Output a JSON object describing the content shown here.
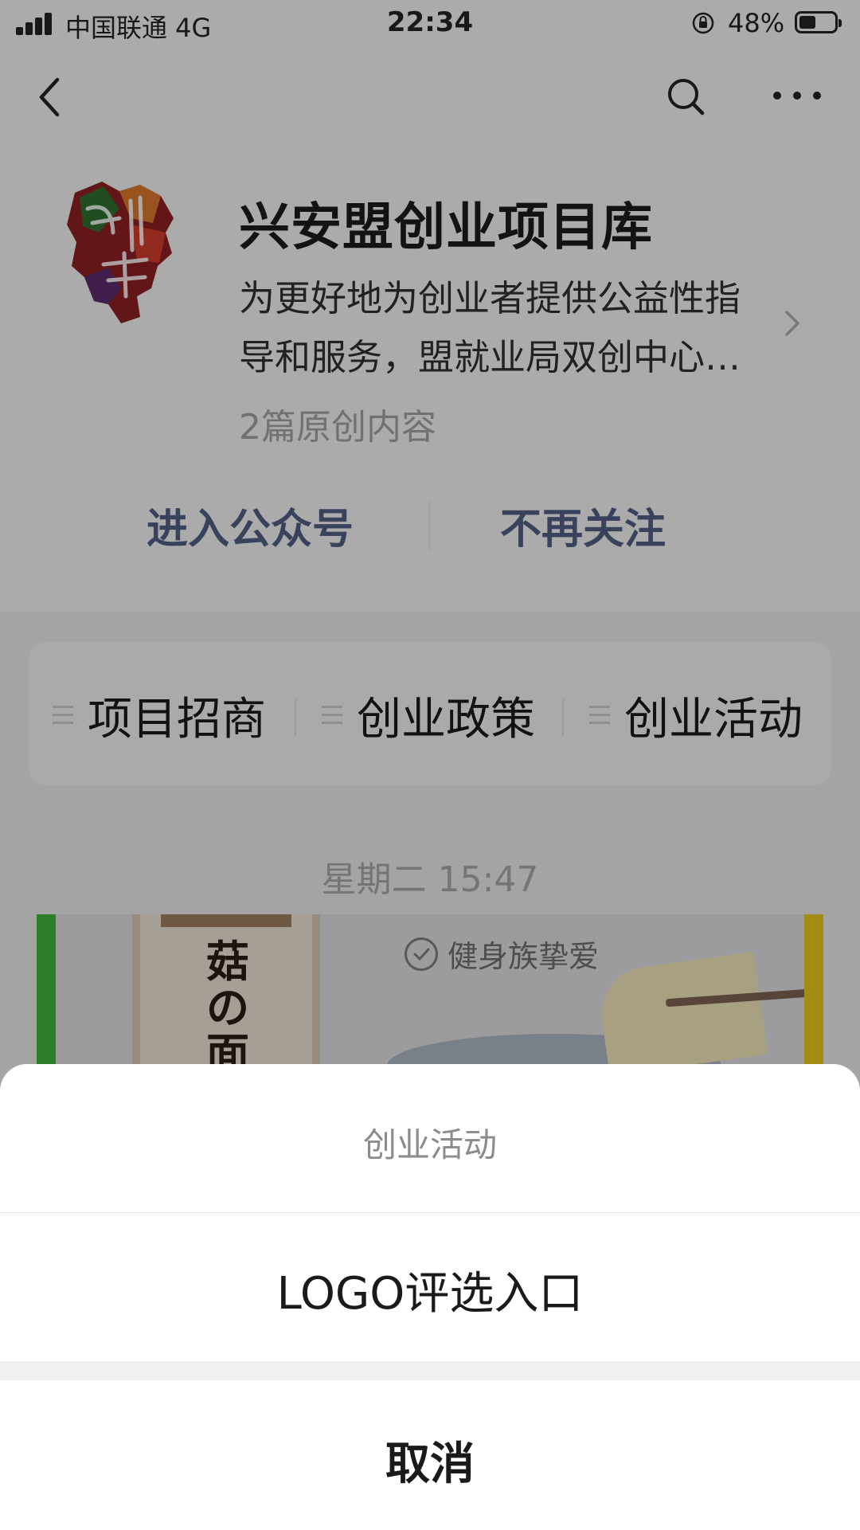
{
  "status_bar": {
    "carrier": "中国联通  4G",
    "time": "22:34",
    "battery": "48%",
    "battery_level": 0.48
  },
  "account": {
    "name": "兴安盟创业项目库",
    "description_line1": "为更好地为创业者提供公益性指",
    "description_line2": "导和服务，盟就业局双创中心…",
    "original_count": "2篇原创内容",
    "enter_label": "进入公众号",
    "unfollow_label": "不再关注"
  },
  "menu": {
    "items": [
      {
        "label": "项目招商"
      },
      {
        "label": "创业政策"
      },
      {
        "label": "创业活动"
      }
    ]
  },
  "feed": {
    "timestamp": "星期二 15:47",
    "cover_pack_title": "菇の面",
    "cover_badge": "健身族挚爱"
  },
  "action_sheet": {
    "title": "创业活动",
    "option": "LOGO评选入口",
    "cancel": "取消"
  },
  "colors": {
    "link_blue": "#4e5c80",
    "green_strip": "#3fae3a",
    "yellow_strip": "#e2c21a"
  }
}
